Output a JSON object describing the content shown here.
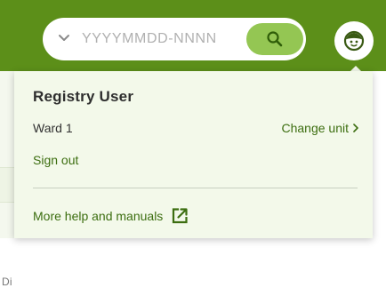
{
  "header": {
    "search": {
      "placeholder": "YYYYMMDD-NNNN",
      "value": ""
    }
  },
  "background": {
    "fragment_text": "Di"
  },
  "user_menu": {
    "title": "Registry User",
    "unit_name": "Ward 1",
    "change_unit_label": "Change unit",
    "sign_out_label": "Sign out",
    "help_label": "More help and manuals"
  },
  "icons": {
    "search_dropdown": "chevron-down-icon",
    "search_button": "search-icon",
    "avatar": "user-face-icon",
    "change_unit": "chevron-right-icon",
    "help": "external-link-icon"
  },
  "colors": {
    "header_green": "#5c8f19",
    "search_button_green": "#94c653",
    "link_green": "#3c6e10",
    "panel_background": "#f3f9ea"
  }
}
